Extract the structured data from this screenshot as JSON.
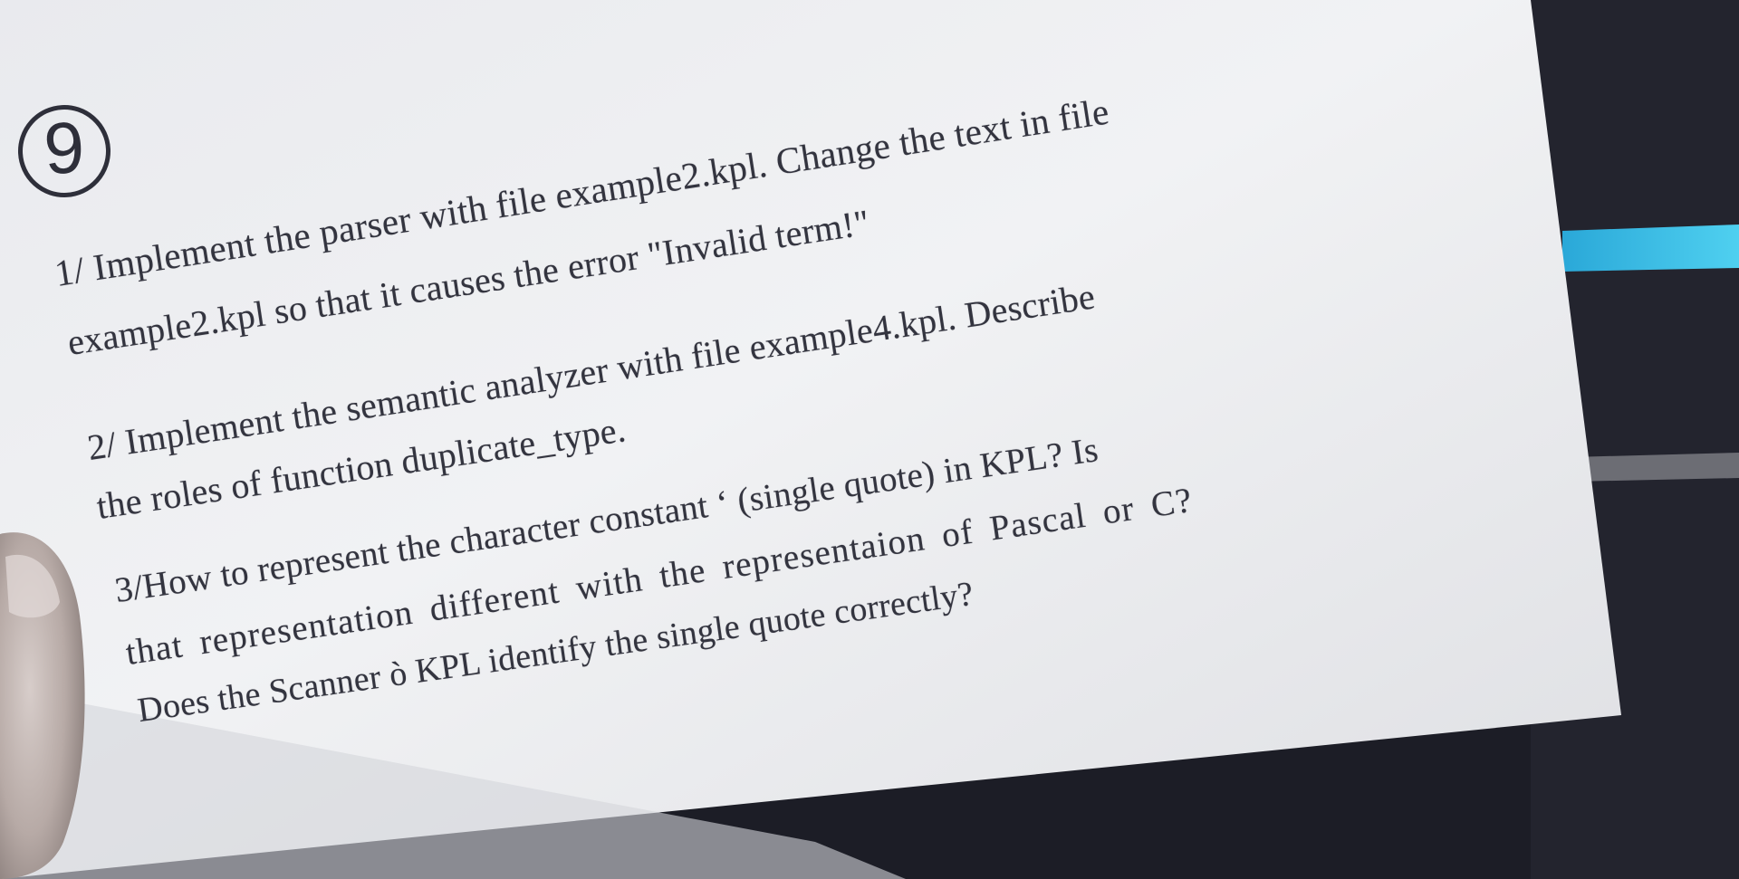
{
  "photo": {
    "background_color": "#1c1d26",
    "paper_color": "#eeeff2",
    "accent_color": "#3fc3e8",
    "circled_number": "9",
    "lines": [
      "1/ Implement the parser with file example2.kpl. Change the text in file",
      "example2.kpl so that it causes the error \"Invalid term!\"",
      "2/ Implement the semantic analyzer with file example4.kpl. Describe",
      "the roles of function duplicate_type.",
      "3/How to represent the character constant ‘ (single quote) in KPL? Is",
      "that representation different with the representaion of Pascal or C?",
      "Does the Scanner ò KPL identify the single quote correctly?"
    ]
  }
}
